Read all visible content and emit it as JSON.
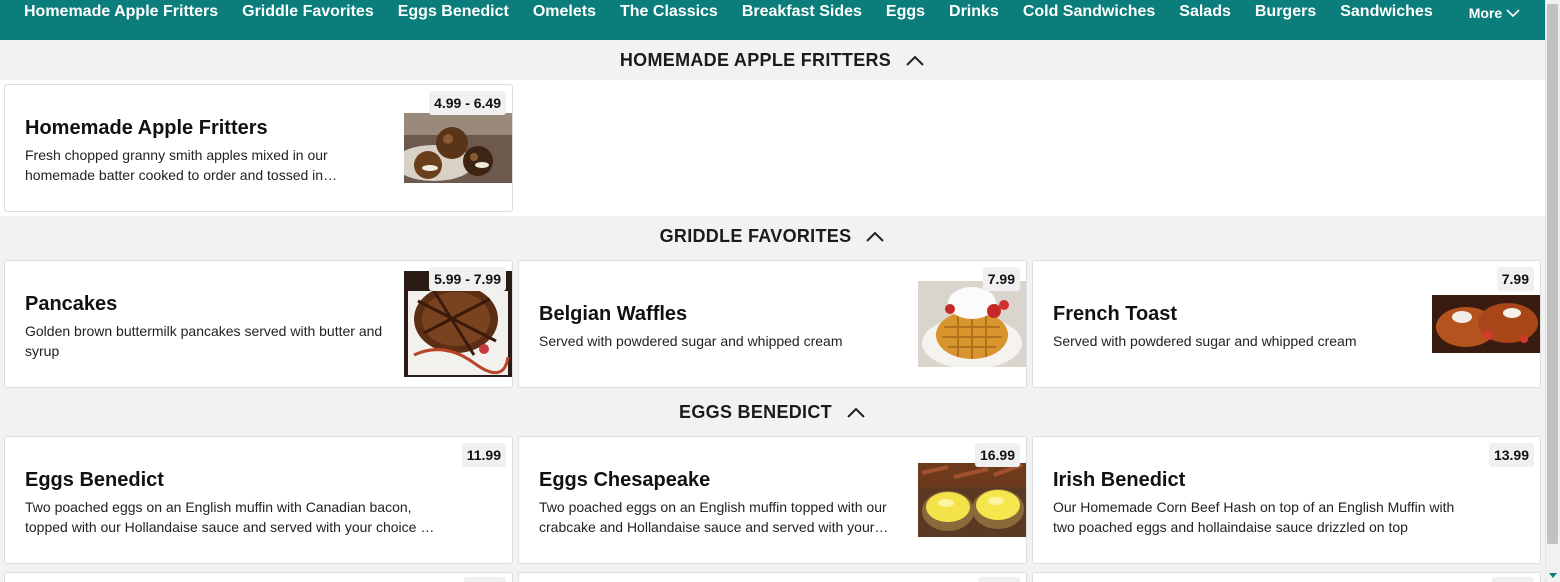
{
  "nav": {
    "items": [
      "Homemade Apple Fritters",
      "Griddle Favorites",
      "Eggs Benedict",
      "Omelets",
      "The Classics",
      "Breakfast Sides",
      "Eggs",
      "Drinks",
      "Cold Sandwiches",
      "Salads",
      "Burgers",
      "Sandwiches"
    ],
    "more_label": "More"
  },
  "sections": [
    {
      "title": "HOMEMADE APPLE FRITTERS",
      "items": [
        {
          "name": "Homemade Apple Fritters",
          "desc": "Fresh chopped granny smith apples mixed in our homemade batter cooked to order and tossed in Cinnamon Sugar",
          "price": "4.99 - 6.49",
          "has_image": true
        }
      ]
    },
    {
      "title": "GRIDDLE FAVORITES",
      "items": [
        {
          "name": "Pancakes",
          "desc": "Golden brown buttermilk pancakes served with butter and syrup",
          "price": "5.99 - 7.99",
          "has_image": true
        },
        {
          "name": "Belgian Waffles",
          "desc": "Served with powdered sugar and whipped cream",
          "price": "7.99",
          "has_image": true
        },
        {
          "name": "French Toast",
          "desc": "Served with powdered sugar and whipped cream",
          "price": "7.99",
          "has_image": true
        }
      ]
    },
    {
      "title": "EGGS BENEDICT",
      "items": [
        {
          "name": "Eggs Benedict",
          "desc": "Two poached eggs on an English muffin with Canadian bacon, topped with our Hollandaise sauce and served with your choice of side",
          "price": "11.99",
          "has_image": false
        },
        {
          "name": "Eggs Chesapeake",
          "desc": "Two poached eggs on an English muffin topped with our crabcake and Hollandaise sauce and served with your choice of side",
          "price": "16.99",
          "has_image": true
        },
        {
          "name": "Irish Benedict",
          "desc": "Our Homemade Corn Beef Hash on top of an English Muffin with two poached eggs and hollaindaise sauce drizzled on top",
          "price": "13.99",
          "has_image": false
        }
      ]
    }
  ],
  "colors": {
    "nav_bg": "#0b7d7a",
    "page_bg": "#f2f2f2",
    "card_bg": "#ffffff"
  },
  "icons": {
    "more": "chevron-down-icon",
    "collapse": "chevron-up-icon"
  }
}
